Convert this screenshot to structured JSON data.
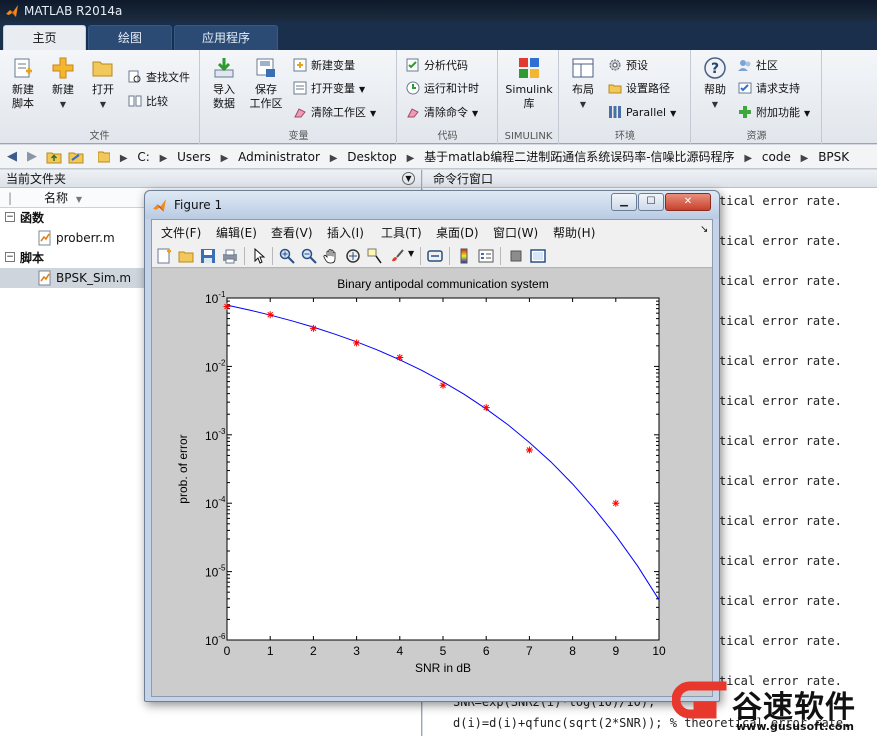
{
  "window": {
    "title": "MATLAB R2014a"
  },
  "tabs": [
    {
      "label": "主页",
      "active": true
    },
    {
      "label": "绘图",
      "active": false
    },
    {
      "label": "应用程序",
      "active": false
    }
  ],
  "ribbon": {
    "file": {
      "label": "文件",
      "new_script": "新建\n脚本",
      "new": "新建",
      "open": "打开",
      "find_files": "查找文件",
      "compare": "比较"
    },
    "variable": {
      "label": "变量",
      "import_data": "导入\n数据",
      "save_workspace": "保存\n工作区",
      "new_variable": "新建变量",
      "open_variable": "打开变量",
      "clear_workspace": "清除工作区"
    },
    "code": {
      "label": "代码",
      "analyze_code": "分析代码",
      "run_and_time": "运行和计时",
      "clear_commands": "清除命令"
    },
    "simulink": {
      "label": "SIMULINK",
      "library": "Simulink\n库"
    },
    "environment": {
      "label": "环境",
      "layout": "布局",
      "preferences": "预设",
      "set_path": "设置路径",
      "parallel": "Parallel"
    },
    "resources": {
      "label": "资源",
      "help": "帮助",
      "community": "社区",
      "request_support": "请求支持",
      "add_ons": "附加功能"
    }
  },
  "address": {
    "segments": [
      "C:",
      "Users",
      "Administrator",
      "Desktop",
      "基于matlab编程二进制跖通信系统误码率-信噪比源码程序",
      "code",
      "BPSK"
    ]
  },
  "current_folder": {
    "title": "当前文件夹",
    "column_name": "名称",
    "groups": [
      {
        "label": "函数",
        "files": [
          "proberr.m"
        ]
      },
      {
        "label": "脚本",
        "files": [
          "BPSK_Sim.m"
        ]
      }
    ]
  },
  "command_window": {
    "title": "命令行窗口",
    "repeat_text": "tical error rate.",
    "partial_line": "SNR=exp(SNR2(i)*log(10)/10);",
    "last_line": "d(i)=d(i)+qfunc(sqrt(2*SNR)); % theoretical error rate."
  },
  "figure": {
    "title": "Figure 1",
    "menus": [
      "文件(F)",
      "编辑(E)",
      "查看(V)",
      "插入(I)",
      "工具(T)",
      "桌面(D)",
      "窗口(W)",
      "帮助(H)"
    ]
  },
  "chart_data": {
    "type": "line",
    "title": "Binary antipodal communication system",
    "xlabel": "SNR in dB",
    "ylabel": "prob. of error",
    "xlim": [
      0,
      10
    ],
    "ylim": [
      1e-06,
      0.1
    ],
    "yscale": "log",
    "xticks": [
      "0",
      "1",
      "2",
      "3",
      "4",
      "5",
      "6",
      "7",
      "8",
      "9",
      "10"
    ],
    "yticks": [
      {
        "base": "10",
        "exp": "-6"
      },
      {
        "base": "10",
        "exp": "-5"
      },
      {
        "base": "10",
        "exp": "-4"
      },
      {
        "base": "10",
        "exp": "-3"
      },
      {
        "base": "10",
        "exp": "-2"
      },
      {
        "base": "10",
        "exp": "-1"
      }
    ],
    "grid": false,
    "series": [
      {
        "style": "line",
        "color": "#0000ff",
        "x": [
          0,
          0.5,
          1,
          1.5,
          2,
          2.5,
          3,
          3.5,
          4,
          4.5,
          5,
          5.5,
          6,
          6.5,
          7,
          7.5,
          8,
          8.5,
          9,
          9.5,
          10
        ],
        "y": [
          0.0786,
          0.0671,
          0.0563,
          0.0464,
          0.0375,
          0.0296,
          0.0229,
          0.0172,
          0.0125,
          0.00881,
          0.00596,
          0.00387,
          0.00239,
          0.00141,
          0.000773,
          0.000401,
          0.000191,
          8.34e-05,
          3.36e-05,
          1.22e-05,
          3.87e-06
        ]
      },
      {
        "style": "marker",
        "marker": "*",
        "color": "#ff0000",
        "x": [
          0,
          1,
          2,
          3,
          4,
          5,
          6,
          7,
          9
        ],
        "y": [
          0.075,
          0.057,
          0.036,
          0.022,
          0.0135,
          0.0053,
          0.0025,
          0.0006,
          0.0001
        ]
      }
    ]
  },
  "watermark": {
    "text": "谷速软件",
    "url": "www.gususoft.com",
    "color": "#e8372c"
  }
}
